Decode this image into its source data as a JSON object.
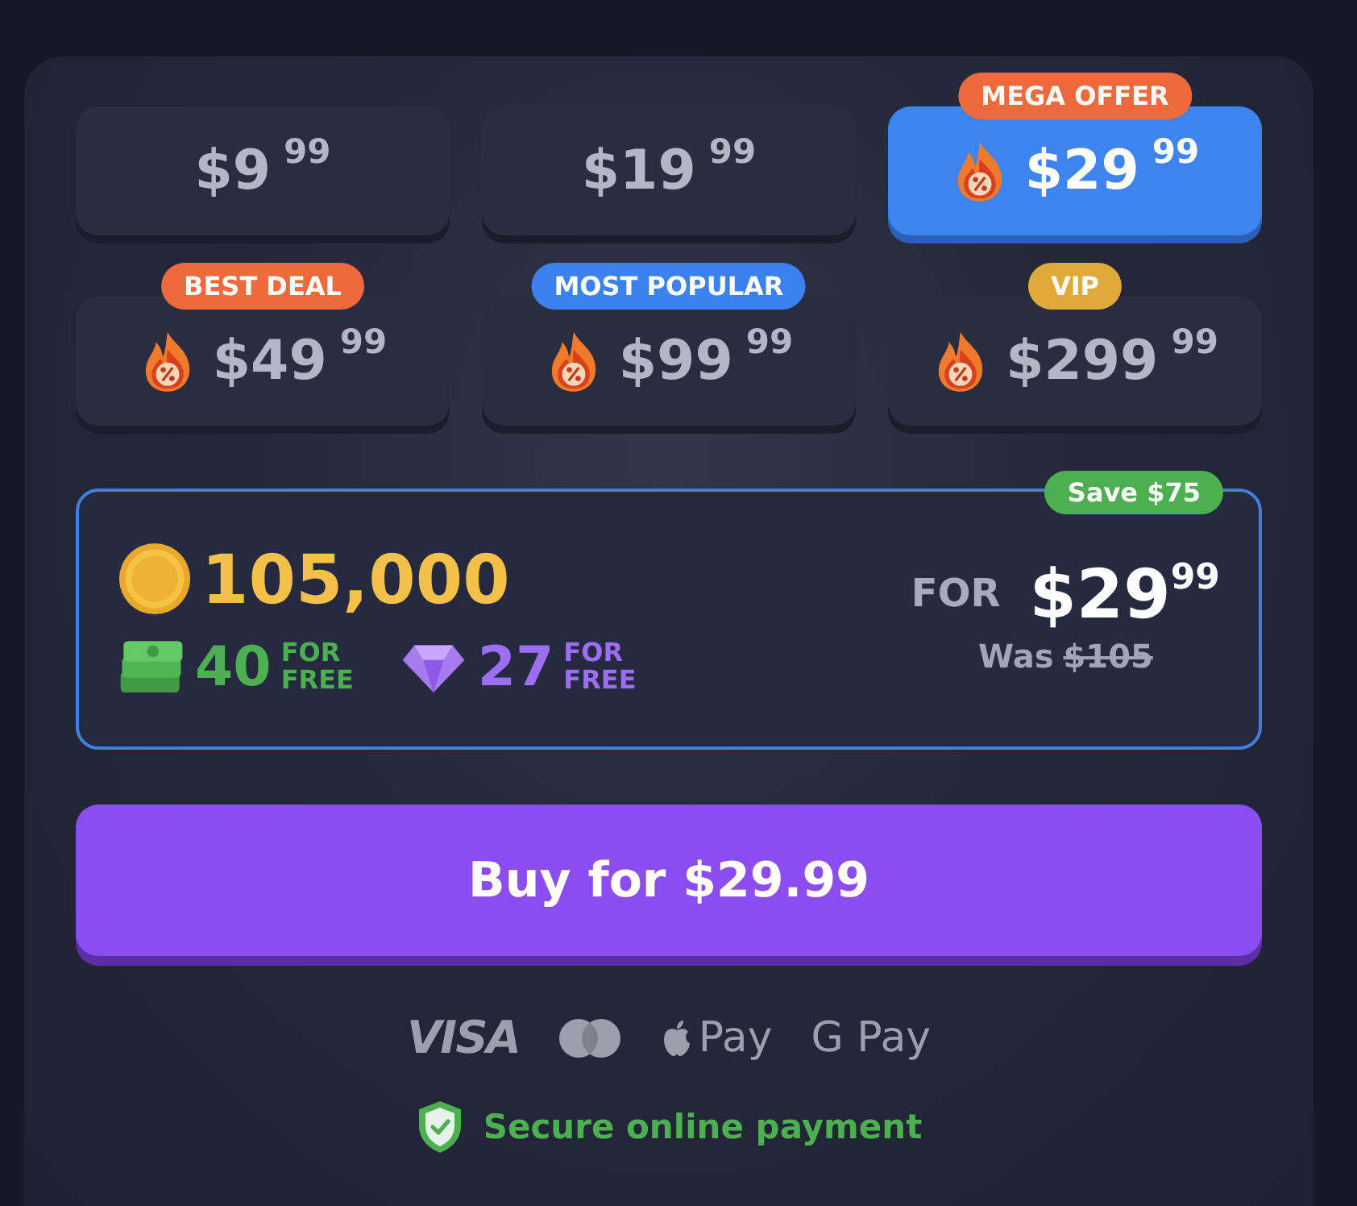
{
  "packages": [
    {
      "price": "$9",
      "cents": "99",
      "hot": false,
      "selected": false
    },
    {
      "price": "$19",
      "cents": "99",
      "hot": false,
      "selected": false
    },
    {
      "price": "$29",
      "cents": "99",
      "hot": true,
      "selected": true,
      "badge": {
        "text": "MEGA OFFER",
        "color": "#ee6a3d"
      }
    },
    {
      "price": "$49",
      "cents": "99",
      "hot": true,
      "selected": false,
      "badge": {
        "text": "BEST DEAL",
        "color": "#ee6a3d"
      }
    },
    {
      "price": "$99",
      "cents": "99",
      "hot": true,
      "selected": false,
      "badge": {
        "text": "MOST POPULAR",
        "color": "#3b82ee"
      }
    },
    {
      "price": "$299",
      "cents": "99",
      "hot": true,
      "selected": false,
      "badge": {
        "text": "VIP",
        "color": "#e0a93a"
      }
    }
  ],
  "offer": {
    "save_badge": "Save $75",
    "coins": "105,000",
    "bonuses": [
      {
        "kind": "cash",
        "amount": "40",
        "note": "FOR FREE"
      },
      {
        "kind": "gem",
        "amount": "27",
        "note": "FOR FREE"
      }
    ],
    "for_label": "FOR",
    "price": "$29",
    "cents": "99",
    "was_label": "Was",
    "was_price": "$105"
  },
  "buy_button": "Buy for $29.99",
  "payment_methods": [
    {
      "kind": "visa",
      "text": "VISA"
    },
    {
      "kind": "card"
    },
    {
      "kind": "apple",
      "text": "Pay"
    },
    {
      "kind": "google",
      "text": "G Pay"
    }
  ],
  "secure_note": "Secure online payment"
}
